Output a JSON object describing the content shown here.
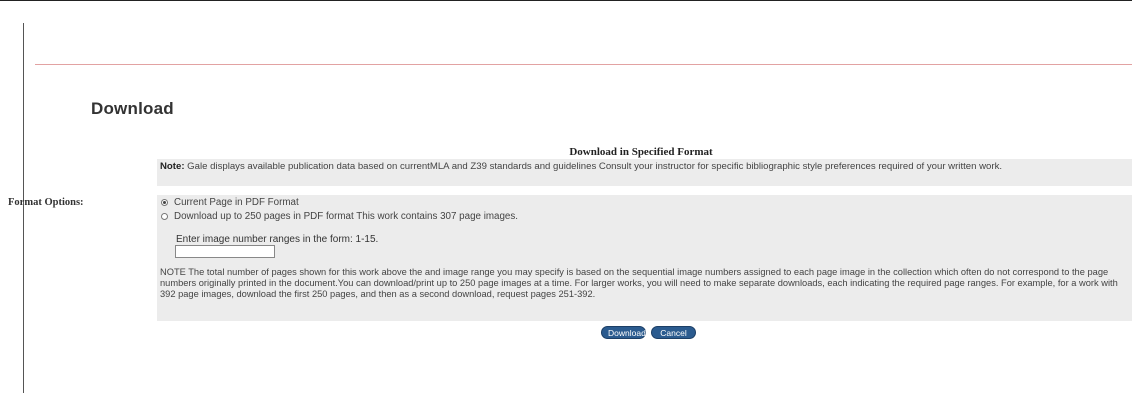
{
  "page": {
    "title": "Download"
  },
  "form": {
    "section_title": "Download in Specified Format",
    "note_label": "Note:",
    "note_text": " Gale displays available publication data based on currentMLA and Z39 standards and guidelines Consult your instructor for specific bibliographic style preferences required of your written work.",
    "format_options_label": "Format Options:",
    "options": [
      {
        "label": "Current Page in PDF Format",
        "selected": true
      },
      {
        "label": "Download up to 250 pages in PDF format This work contains 307 page images.",
        "selected": false
      }
    ],
    "range_hint": "Enter image number ranges in the form: 1-15.",
    "range_value": "",
    "footnote": "NOTE The total number of pages shown for this work above the and image range you may specify is based on the sequential image numbers assigned to each page image in the collection which often do not correspond to the page numbers originally printed in the document.You can download/print up to 250 page images at a time. For larger works, you will need to make separate downloads, each indicating the required page ranges. For example, for a work with 392 page images, download the first 250 pages, and then as a second download, request pages 251-392."
  },
  "buttons": {
    "download_label": "Download",
    "cancel_label": "Cancel"
  },
  "colors": {
    "accent_rule": "#e2a2a2",
    "button_bg": "#2b5b8f",
    "panel_bg": "#ececec"
  }
}
